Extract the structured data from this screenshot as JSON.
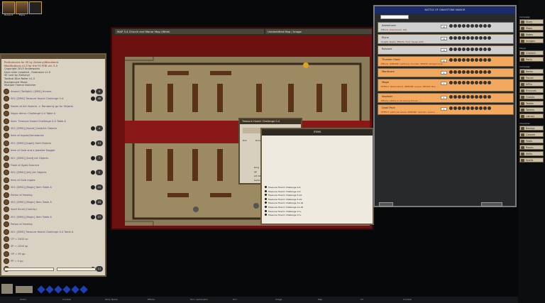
{
  "portraits": [
    {
      "name": "Rolvand"
    },
    {
      "name": "Elyna"
    }
  ],
  "chat": {
    "header_lines": [
      "Proficiencies for 5E by Zarkanyl/Blackforrd",
      "Modifications v1.0 for the FG PHB ver. 5.0",
      "Copyright 2015 Smiteworks",
      "Dice roller installed - Extension v1.0",
      "5E Lore by Zarkanyl",
      "Tactical Dice Roller v1.3",
      "Background Music",
      "Multiple Theme Switcher"
    ],
    "rolls": [
      {
        "text": "Arsand (Twilight): [DMG] Arcane",
        "value": "4"
      },
      {
        "text": "ISO: [DMG] Treasure Hoard Challenge 0-4",
        "value": "45"
      },
      {
        "text": "Dozen of Art Objects -> Randomly go for Objects",
        "value": ""
      },
      {
        "text": "Magic Items: Challenge 0-4 Table A",
        "value": ""
      },
      {
        "text": "Item: Treasure Hoard Challenge 0-4 Table A",
        "value": ""
      },
      {
        "text": "ISO: [DMG] [Hoard] Gold/Art Objects",
        "value": "4"
      },
      {
        "text": "Item of Ingots/Gemstones",
        "value": ""
      },
      {
        "text": "ISO: [DMG] [Ingot] Gold Objects",
        "value": "11"
      },
      {
        "text": "Item of Gold and a jeweled Dagger",
        "value": ""
      },
      {
        "text": "ISO: [DMG] [Gold] Art Objects",
        "value": "7"
      },
      {
        "text": "Flask of Aged Essence",
        "value": ""
      },
      {
        "text": "ISO: [DMG] [Art] Art Objects",
        "value": "2"
      },
      {
        "text": "Item of Gold Ingots",
        "value": ""
      },
      {
        "text": "ISO: [DMG] [Magic] Item Table A",
        "value": "41"
      },
      {
        "text": "Potion of Healing",
        "value": ""
      },
      {
        "text": "ISO: [DMG] [Magic] Item Table A",
        "value": "15"
      },
      {
        "text": "Spell Scroll (Cantrip)",
        "value": ""
      },
      {
        "text": "ISO: [DMG] [Magic] Item Table A",
        "value": "27"
      },
      {
        "text": "Potion of Healing",
        "value": ""
      },
      {
        "text": "ISO: [DMG] Treasure Hoard Challenge 0-4 Table A",
        "value": ""
      },
      {
        "text": "CP = 2400 cp",
        "value": ""
      },
      {
        "text": "SP = 1000 sp",
        "value": ""
      },
      {
        "text": "GP = 90 gp",
        "value": ""
      },
      {
        "text": "PP = 0 pp",
        "value": ""
      },
      {
        "text": "Rolvand - [Skill] Insight [WIS]",
        "value": "11"
      }
    ]
  },
  "map": {
    "tabs": [
      {
        "label": "MAP 3-4 Church and Manor Map (Wide)"
      },
      {
        "label": "Unidentified Map / Image"
      }
    ]
  },
  "ct": {
    "title": "BATTLE OF GRAYSTONE MANOR",
    "entries": [
      {
        "name": "Adventurer",
        "effects": "Effects: [Darkvision: 60]",
        "num": "16",
        "color": "#d0d0d0"
      },
      {
        "name": "Elyna",
        "effects": "Knight: Spells: Effects: Fold: Sense both",
        "num": "14",
        "color": "#d0d0d0"
      },
      {
        "name": "Rolvand",
        "effects": "",
        "num": "13",
        "color": "#d0d0d0"
      },
      {
        "name": "Thunder Giant",
        "effects": "Effects: IMMUNE: lightning, thunder; RESIST: bludgeoning; ...",
        "num": "10",
        "color": "#f3a860"
      },
      {
        "name": "Manticore",
        "effects": "",
        "num": "9",
        "color": "#f3a860"
      },
      {
        "name": "Mage",
        "effects": "EFFECT: [Darkvision]; IMMUNE: poison; RESIST: fire; ...",
        "num": "7",
        "color": "#f3a860"
      },
      {
        "name": "Assassin",
        "effects": "Effects: [ADV] on all saving throws; ...",
        "num": "5",
        "color": "#f3a860"
      },
      {
        "name": "Gnoll Pack",
        "effects": "EFFECT: [ADV] all saves; IMMUNE: necrotic, poison; ...",
        "num": "3",
        "color": "#f3a860"
      }
    ]
  },
  "treasure": {
    "title": "Treasure Hoard: Challenge 0-4",
    "cols": [
      "Roll",
      "Dozen of",
      "Magic Items",
      "Items"
    ],
    "rows": [
      "Dmg",
      "gp",
      "Art Objects",
      "Gems"
    ]
  },
  "items": {
    "title": "ITEMS",
    "rows": [
      "Treasure Hoard: Challenge 0-4",
      "Treasure Hoard: Challenge 0-4",
      "Treasure Hoard: Challenge 5-10",
      "Treasure Hoard: Challenge 5-10",
      "Treasure Hoard: Challenge 11-16",
      "Treasure Hoard: Challenge 11-16",
      "Treasure Hoard: Challenge 17+",
      "Treasure Hoard: Challenge 17+"
    ]
  },
  "sidebar": {
    "groups": [
      {
        "head": "Campaign",
        "items": [
          "Story",
          "Maps",
          "Notes",
          "Images"
        ]
      },
      {
        "head": "Player",
        "items": [
          "Charact.",
          "Party"
        ]
      },
      {
        "head": "Campaign",
        "items": [
          "Items",
          "Parcel",
          "NPCs",
          "Encount.",
          "Quests",
          "Tables",
          "Tokens",
          "Library"
        ]
      },
      {
        "head": "Character",
        "items": [
          "Backgr.",
          "Classes",
          "Feats",
          "Races",
          "Skills",
          "Spells"
        ]
      }
    ]
  },
  "hotkeys": [
    "Action",
    "Combat",
    "Story Name",
    "Effects",
    "Turn: Automaton",
    "Turn",
    "Image",
    "Map",
    "CT",
    "Combat"
  ]
}
